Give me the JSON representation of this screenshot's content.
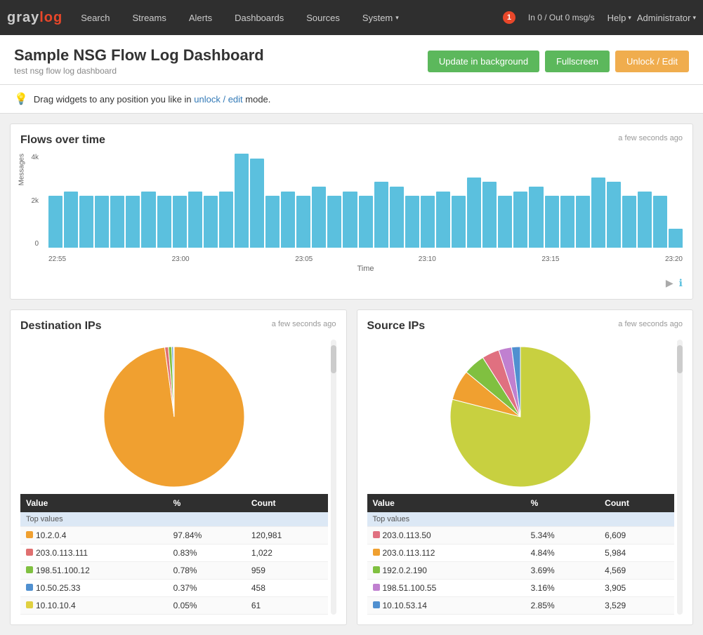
{
  "logo": {
    "gray": "gray",
    "log": "log"
  },
  "nav": {
    "items": [
      {
        "label": "Search",
        "id": "search"
      },
      {
        "label": "Streams",
        "id": "streams"
      },
      {
        "label": "Alerts",
        "id": "alerts"
      },
      {
        "label": "Dashboards",
        "id": "dashboards"
      },
      {
        "label": "Sources",
        "id": "sources"
      },
      {
        "label": "System",
        "id": "system"
      }
    ],
    "badge": "1",
    "msgs": "In 0 / Out 0 msg/s",
    "help": "Help",
    "admin": "Administrator"
  },
  "header": {
    "title": "Sample NSG Flow Log Dashboard",
    "subtitle": "test nsg flow log dashboard",
    "btn_update": "Update in background",
    "btn_fullscreen": "Fullscreen",
    "btn_unlock": "Unlock / Edit"
  },
  "infobar": {
    "text1": "Drag widgets to any position you like in ",
    "link": "unlock / edit",
    "text2": " mode."
  },
  "flows_chart": {
    "title": "Flows over time",
    "time": "a few seconds ago",
    "x_label": "Time",
    "y_label": "Messages",
    "x_ticks": [
      "22:55",
      "23:00",
      "23:05",
      "23:10",
      "23:15",
      "23:20"
    ],
    "bars": [
      55,
      60,
      55,
      55,
      55,
      55,
      60,
      55,
      55,
      60,
      55,
      60,
      100,
      95,
      55,
      60,
      55,
      65,
      55,
      60,
      55,
      70,
      65,
      55,
      55,
      60,
      55,
      75,
      70,
      55,
      60,
      65,
      55,
      55,
      55,
      75,
      70,
      55,
      60,
      55,
      20
    ],
    "y_ticks": [
      "4k",
      "2k",
      "0"
    ]
  },
  "destination_ips": {
    "title": "Destination IPs",
    "time": "a few seconds ago",
    "table_headers": [
      "Value",
      "%",
      "Count"
    ],
    "top_values_label": "Top values",
    "rows": [
      {
        "color": "#f0a030",
        "value": "10.2.0.4",
        "pct": "97.84%",
        "count": "120,981"
      },
      {
        "color": "#e07070",
        "value": "203.0.113.111",
        "pct": "0.83%",
        "count": "1,022"
      },
      {
        "color": "#80c040",
        "value": "198.51.100.12",
        "pct": "0.78%",
        "count": "959"
      },
      {
        "color": "#5090d0",
        "value": "10.50.25.33",
        "pct": "0.37%",
        "count": "458"
      },
      {
        "color": "#e0d040",
        "value": "10.10.10.4",
        "pct": "0.05%",
        "count": "61"
      }
    ],
    "pie_slices": [
      {
        "color": "#f0a030",
        "pct": 97.84
      },
      {
        "color": "#e07070",
        "pct": 0.83
      },
      {
        "color": "#80c040",
        "pct": 0.78
      },
      {
        "color": "#5090d0",
        "pct": 0.37
      },
      {
        "color": "#e0d040",
        "pct": 0.05
      },
      {
        "color": "#aaa",
        "pct": 0.13
      }
    ]
  },
  "source_ips": {
    "title": "Source IPs",
    "time": "a few seconds ago",
    "table_headers": [
      "Value",
      "%",
      "Count"
    ],
    "top_values_label": "Top values",
    "rows": [
      {
        "color": "#e07080",
        "value": "203.0.113.50",
        "pct": "5.34%",
        "count": "6,609"
      },
      {
        "color": "#f0a030",
        "value": "203.0.113.112",
        "pct": "4.84%",
        "count": "5,984"
      },
      {
        "color": "#80c040",
        "value": "192.0.2.190",
        "pct": "3.69%",
        "count": "4,569"
      },
      {
        "color": "#c080d0",
        "value": "198.51.100.55",
        "pct": "3.16%",
        "count": "3,905"
      },
      {
        "color": "#5090d0",
        "value": "10.10.53.14",
        "pct": "2.85%",
        "count": "3,529"
      }
    ],
    "pie_slices": [
      {
        "color": "#c8d040",
        "pct": 79
      },
      {
        "color": "#f0a030",
        "pct": 7
      },
      {
        "color": "#80c040",
        "pct": 5
      },
      {
        "color": "#e07080",
        "pct": 4
      },
      {
        "color": "#c080d0",
        "pct": 3
      },
      {
        "color": "#5090d0",
        "pct": 2
      }
    ]
  }
}
